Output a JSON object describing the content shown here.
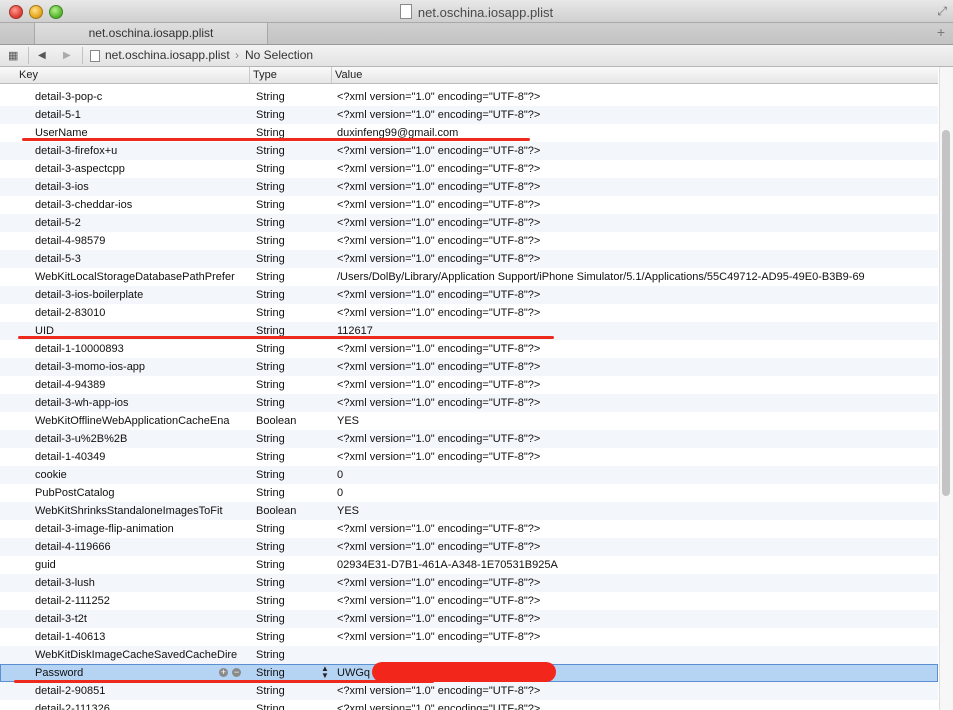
{
  "window": {
    "title": "net.oschina.iosapp.plist"
  },
  "tabs": [
    {
      "label": "net.oschina.iosapp.plist"
    }
  ],
  "jumpbar": {
    "file": "net.oschina.iosapp.plist",
    "selection": "No Selection"
  },
  "columns": {
    "key": "Key",
    "type": "Type",
    "value": "Value"
  },
  "rows": [
    {
      "key": "detail-3-pop-c",
      "type": "String",
      "value": "<?xml version=\"1.0\" encoding=\"UTF-8\"?>"
    },
    {
      "key": "detail-5-1",
      "type": "String",
      "value": "<?xml version=\"1.0\" encoding=\"UTF-8\"?>"
    },
    {
      "key": "UserName",
      "type": "String",
      "value": "duxinfeng99@gmail.com"
    },
    {
      "key": "detail-3-firefox+u",
      "type": "String",
      "value": "<?xml version=\"1.0\" encoding=\"UTF-8\"?>"
    },
    {
      "key": "detail-3-aspectcpp",
      "type": "String",
      "value": "<?xml version=\"1.0\" encoding=\"UTF-8\"?>"
    },
    {
      "key": "detail-3-ios",
      "type": "String",
      "value": "<?xml version=\"1.0\" encoding=\"UTF-8\"?>"
    },
    {
      "key": "detail-3-cheddar-ios",
      "type": "String",
      "value": "<?xml version=\"1.0\" encoding=\"UTF-8\"?>"
    },
    {
      "key": "detail-5-2",
      "type": "String",
      "value": "<?xml version=\"1.0\" encoding=\"UTF-8\"?>"
    },
    {
      "key": "detail-4-98579",
      "type": "String",
      "value": "<?xml version=\"1.0\" encoding=\"UTF-8\"?>"
    },
    {
      "key": "detail-5-3",
      "type": "String",
      "value": "<?xml version=\"1.0\" encoding=\"UTF-8\"?>"
    },
    {
      "key": "WebKitLocalStorageDatabasePathPrefer",
      "type": "String",
      "value": "/Users/DolBy/Library/Application Support/iPhone Simulator/5.1/Applications/55C49712-AD95-49E0-B3B9-69"
    },
    {
      "key": "detail-3-ios-boilerplate",
      "type": "String",
      "value": "<?xml version=\"1.0\" encoding=\"UTF-8\"?>"
    },
    {
      "key": "detail-2-83010",
      "type": "String",
      "value": "<?xml version=\"1.0\" encoding=\"UTF-8\"?>"
    },
    {
      "key": "UID",
      "type": "String",
      "value": "112617"
    },
    {
      "key": "detail-1-10000893",
      "type": "String",
      "value": "<?xml version=\"1.0\" encoding=\"UTF-8\"?>"
    },
    {
      "key": "detail-3-momo-ios-app",
      "type": "String",
      "value": "<?xml version=\"1.0\" encoding=\"UTF-8\"?>"
    },
    {
      "key": "detail-4-94389",
      "type": "String",
      "value": "<?xml version=\"1.0\" encoding=\"UTF-8\"?>"
    },
    {
      "key": "detail-3-wh-app-ios",
      "type": "String",
      "value": "<?xml version=\"1.0\" encoding=\"UTF-8\"?>"
    },
    {
      "key": "WebKitOfflineWebApplicationCacheEna",
      "type": "Boolean",
      "value": "YES"
    },
    {
      "key": "detail-3-u%2B%2B",
      "type": "String",
      "value": "<?xml version=\"1.0\" encoding=\"UTF-8\"?>"
    },
    {
      "key": "detail-1-40349",
      "type": "String",
      "value": "<?xml version=\"1.0\" encoding=\"UTF-8\"?>"
    },
    {
      "key": "cookie",
      "type": "String",
      "value": "0"
    },
    {
      "key": "PubPostCatalog",
      "type": "String",
      "value": "0"
    },
    {
      "key": "WebKitShrinksStandaloneImagesToFit",
      "type": "Boolean",
      "value": "YES"
    },
    {
      "key": "detail-3-image-flip-animation",
      "type": "String",
      "value": "<?xml version=\"1.0\" encoding=\"UTF-8\"?>"
    },
    {
      "key": "detail-4-119666",
      "type": "String",
      "value": "<?xml version=\"1.0\" encoding=\"UTF-8\"?>"
    },
    {
      "key": "guid",
      "type": "String",
      "value": "02934E31-D7B1-461A-A348-1E70531B925A"
    },
    {
      "key": "detail-3-lush",
      "type": "String",
      "value": "<?xml version=\"1.0\" encoding=\"UTF-8\"?>"
    },
    {
      "key": "detail-2-111252",
      "type": "String",
      "value": "<?xml version=\"1.0\" encoding=\"UTF-8\"?>"
    },
    {
      "key": "detail-3-t2t",
      "type": "String",
      "value": "<?xml version=\"1.0\" encoding=\"UTF-8\"?>"
    },
    {
      "key": "detail-1-40613",
      "type": "String",
      "value": "<?xml version=\"1.0\" encoding=\"UTF-8\"?>"
    },
    {
      "key": "WebKitDiskImageCacheSavedCacheDire",
      "type": "String",
      "value": ""
    },
    {
      "key": "Password",
      "type": "String",
      "value": "UWGq",
      "selected": true
    },
    {
      "key": "detail-2-90851",
      "type": "String",
      "value": "<?xml version=\"1.0\" encoding=\"UTF-8\"?>"
    },
    {
      "key": "detail-2-111326",
      "type": "String",
      "value": "<?xml version=\"1.0\" encoding=\"UTF-8\"?>"
    }
  ],
  "colors": {
    "selection": "#b5d3f3",
    "annotation_red": "#ee2a1c"
  }
}
